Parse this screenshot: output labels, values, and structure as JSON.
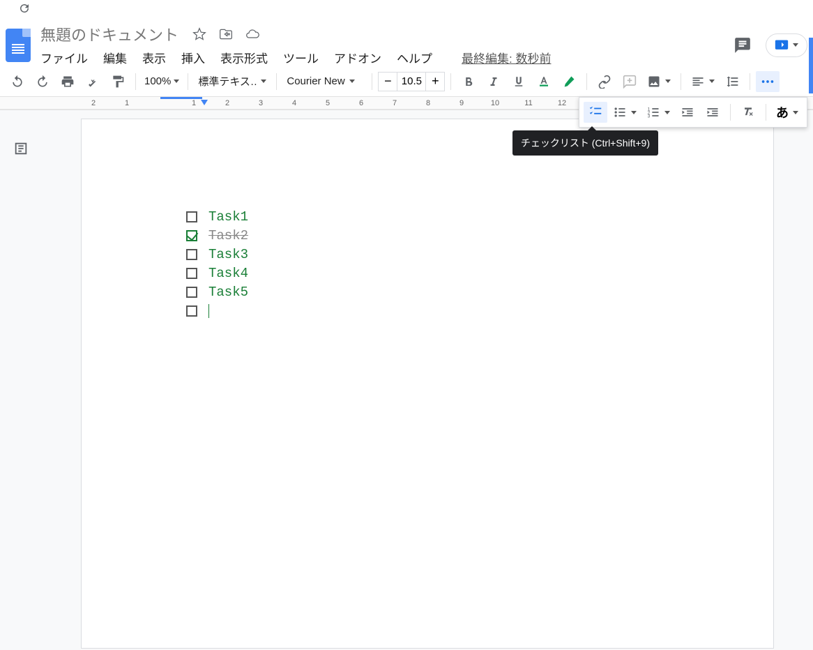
{
  "document": {
    "title": "無題のドキュメント",
    "last_edit": "最終編集: 数秒前"
  },
  "menus": {
    "file": "ファイル",
    "edit": "編集",
    "view": "表示",
    "insert": "挿入",
    "format": "表示形式",
    "tools": "ツール",
    "addons": "アドオン",
    "help": "ヘルプ"
  },
  "toolbar": {
    "zoom": "100%",
    "style": "標準テキス…",
    "font": "Courier New",
    "font_size": "10.5"
  },
  "tooltip": {
    "checklist": "チェックリスト (Ctrl+Shift+9)"
  },
  "ruler": {
    "marks": [
      "2",
      "1",
      "",
      "1",
      "2",
      "3",
      "4",
      "5",
      "6",
      "7",
      "8",
      "9",
      "10",
      "11",
      "12"
    ]
  },
  "content": {
    "tasks": [
      {
        "label": "Task1",
        "checked": false
      },
      {
        "label": "Task2",
        "checked": true
      },
      {
        "label": "Task3",
        "checked": false
      },
      {
        "label": "Task4",
        "checked": false
      },
      {
        "label": "Task5",
        "checked": false
      },
      {
        "label": "",
        "checked": false
      }
    ]
  },
  "ime_label": "あ"
}
